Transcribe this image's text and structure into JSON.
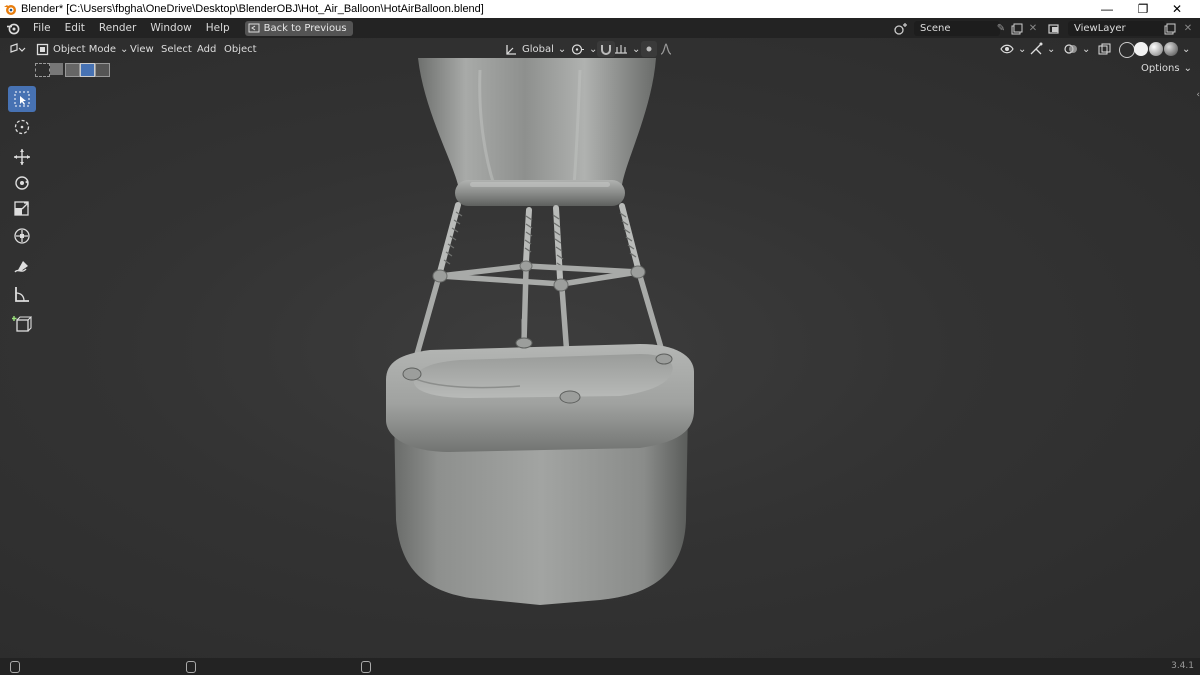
{
  "window": {
    "title": "Blender* [C:\\Users\\fbgha\\OneDrive\\Desktop\\BlenderOBJ\\Hot_Air_Balloon\\HotAirBalloon.blend]",
    "minimize_glyph": "—",
    "maximize_glyph": "❐",
    "close_glyph": "✕"
  },
  "menu": {
    "items": [
      "File",
      "Edit",
      "Render",
      "Window",
      "Help"
    ],
    "back_button": "Back to Previous"
  },
  "scene": {
    "label": "Scene"
  },
  "view_layer": {
    "label": "ViewLayer"
  },
  "viewport_header": {
    "mode": "Object Mode",
    "menus": [
      "View",
      "Select",
      "Add",
      "Object"
    ],
    "transform_orientation": "Global",
    "options_label": "Options"
  },
  "toolbar": {
    "tools": [
      "select-box-tool",
      "cursor-tool",
      "move-tool",
      "rotate-tool",
      "scale-tool",
      "transform-tool",
      "annotate-tool",
      "measure-tool",
      "add-cube-tool"
    ],
    "active": "select-box-tool"
  },
  "status": {
    "version": "3.4.1"
  },
  "colors": {
    "accent": "#4772b3",
    "topbar": "#232323",
    "viewport": "#333333"
  }
}
